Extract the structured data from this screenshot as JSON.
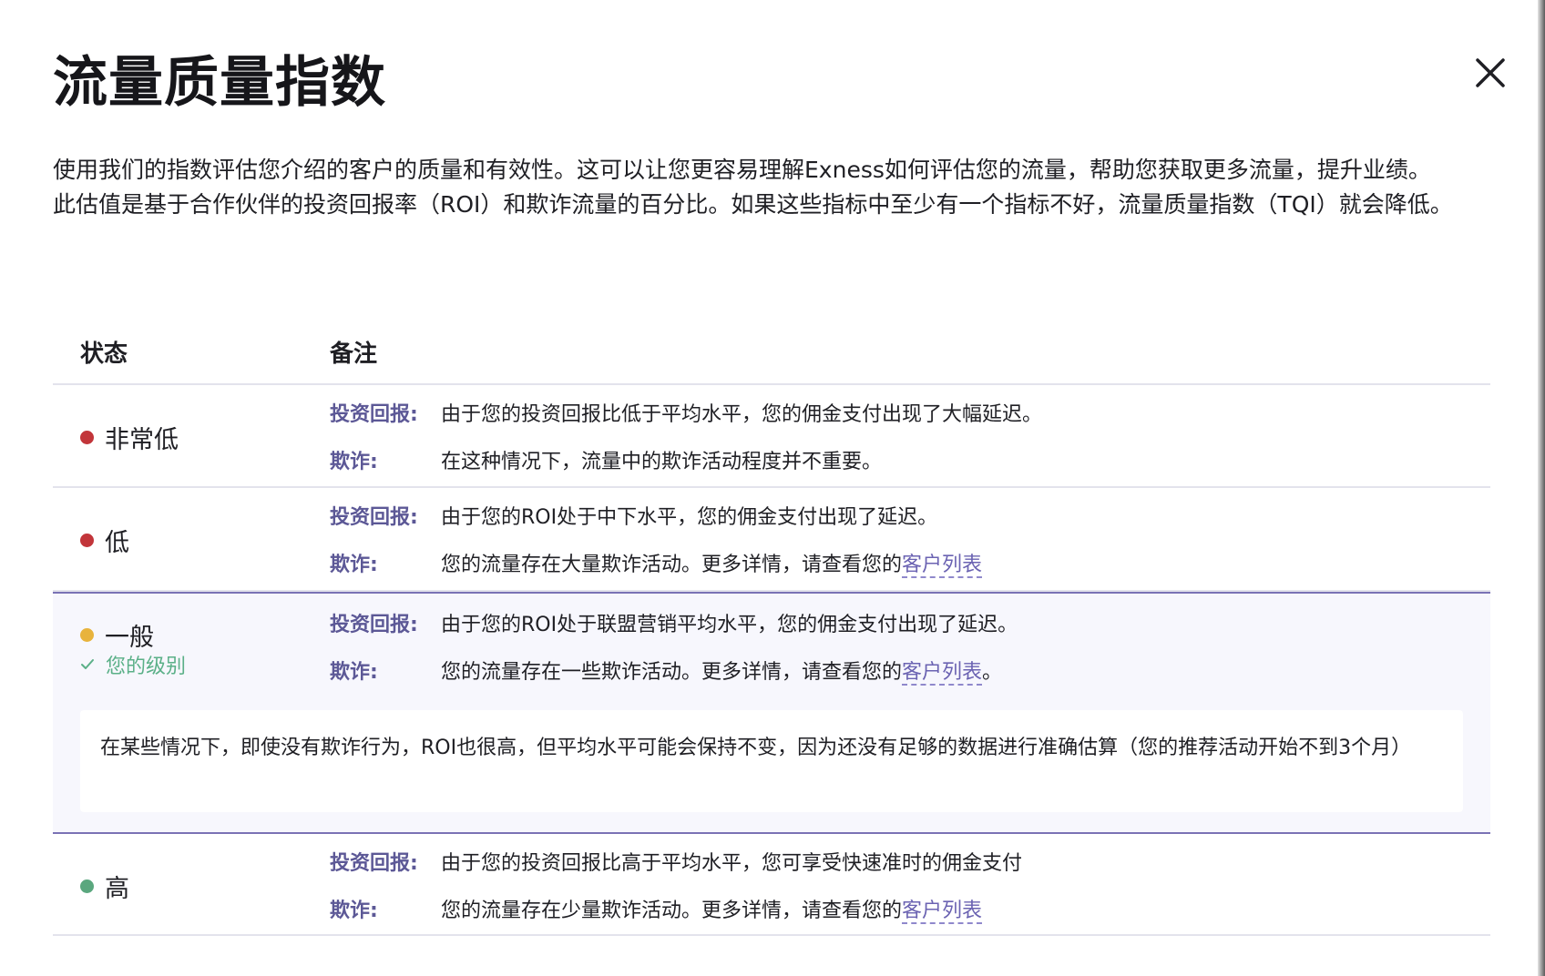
{
  "dialog": {
    "title": "流量质量指数",
    "close_icon": "close-icon",
    "intro": [
      "使用我们的指数评估您介绍的客户的质量和有效性。这可以让您更容易理解Exness如何评估您的流量，帮助您获取更多流量，提升业绩。",
      "此估值是基于合作伙伴的投资回报率（ROI）和欺诈流量的百分比。如果这些指标中至少有一个指标不好，流量质量指数（TQI）就会降低。"
    ]
  },
  "table": {
    "headers": {
      "status": "状态",
      "notes": "备注"
    },
    "rows": [
      {
        "status": "非常低",
        "dot_color": "#c2353a",
        "roi_key": "投资回报:",
        "roi_text": "由于您的投资回报比低于平均水平，您的佣金支付出现了大幅延迟。",
        "fraud_key": "欺诈:",
        "fraud_text": "在这种情况下，流量中的欺诈活动程度并不重要。"
      },
      {
        "status": "低",
        "dot_color": "#c2353a",
        "roi_key": "投资回报:",
        "roi_text": "由于您的ROI处于中下水平，您的佣金支付出现了延迟。",
        "fraud_key": "欺诈:",
        "fraud_text": "您的流量存在大量欺诈活动。更多详情，请查看您的",
        "fraud_link": "客户列表"
      },
      {
        "status": "一般",
        "dot_color": "#e8b33c",
        "current_level_label": "您的级别",
        "roi_key": "投资回报:",
        "roi_text": "由于您的ROI处于联盟营销平均水平，您的佣金支付出现了延迟。",
        "fraud_key": "欺诈:",
        "fraud_text": "您的流量存在一些欺诈活动。更多详情，请查看您的",
        "fraud_link": "客户列表",
        "fraud_suffix": "。",
        "info": "在某些情况下，即使没有欺诈行为，ROI也很高，但平均水平可能会保持不变，因为还没有足够的数据进行准确估算（您的推荐活动开始不到3个月）"
      },
      {
        "status": "高",
        "dot_color": "#5aa77e",
        "roi_key": "投资回报:",
        "roi_text": "由于您的投资回报比高于平均水平，您可享受快速准时的佣金支付",
        "fraud_key": "欺诈:",
        "fraud_text": "您的流量存在少量欺诈活动。更多详情，请查看您的",
        "fraud_link": "客户列表"
      }
    ]
  }
}
